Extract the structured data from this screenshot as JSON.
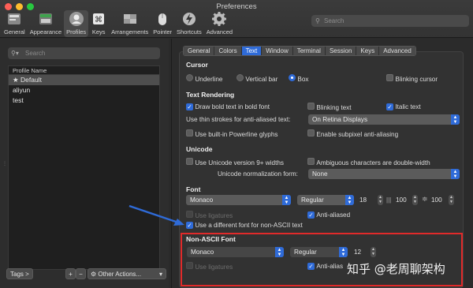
{
  "window": {
    "title": "Preferences"
  },
  "colors": {
    "accent": "#2f6bd8",
    "highlight_box": "#e02a2a",
    "arrow": "#2f6bd8"
  },
  "toolbar": {
    "items": [
      {
        "label": "General",
        "icon": "general-icon"
      },
      {
        "label": "Appearance",
        "icon": "appearance-icon"
      },
      {
        "label": "Profiles",
        "icon": "profiles-icon"
      },
      {
        "label": "Keys",
        "icon": "keys-icon"
      },
      {
        "label": "Arrangements",
        "icon": "arrangements-icon"
      },
      {
        "label": "Pointer",
        "icon": "pointer-icon"
      },
      {
        "label": "Shortcuts",
        "icon": "shortcuts-icon"
      },
      {
        "label": "Advanced",
        "icon": "advanced-icon"
      }
    ],
    "search_placeholder": "Search"
  },
  "profiles": {
    "search_placeholder": "Search",
    "column_header": "Profile Name",
    "items": [
      {
        "name": "Default",
        "default_marker": "★"
      },
      {
        "name": "aliyun"
      },
      {
        "name": "test"
      }
    ],
    "tags_button": "Tags >",
    "add_button": "+",
    "remove_button": "−",
    "other_actions": "Other Actions..."
  },
  "tabs": [
    "General",
    "Colors",
    "Text",
    "Window",
    "Terminal",
    "Session",
    "Keys",
    "Advanced"
  ],
  "text_settings": {
    "cursor": {
      "heading": "Cursor",
      "options": [
        "Underline",
        "Vertical bar",
        "Box"
      ],
      "blinking": "Blinking cursor"
    },
    "rendering": {
      "heading": "Text Rendering",
      "bold": "Draw bold text in bold font",
      "blinking_text": "Blinking text",
      "italic": "Italic text",
      "thin_strokes_label": "Use thin strokes for anti-aliased text:",
      "thin_strokes_value": "On Retina Displays",
      "powerline": "Use built-in Powerline glyphs",
      "subpixel": "Enable subpixel anti-aliasing"
    },
    "unicode": {
      "heading": "Unicode",
      "version": "Use Unicode version 9+ widths",
      "ambiguous": "Ambiguous characters are double-width",
      "normalization_label": "Unicode normalization form:",
      "normalization_value": "None"
    },
    "font": {
      "heading": "Font",
      "family": "Monaco",
      "style": "Regular",
      "size": "18",
      "h_spacing": "100",
      "v_spacing": "100",
      "ligatures": "Use ligatures",
      "anti_aliased": "Anti-aliased",
      "different_non_ascii": "Use a different font for non-ASCII text"
    },
    "non_ascii_font": {
      "heading": "Non-ASCII Font",
      "family": "Monaco",
      "style": "Regular",
      "size": "12",
      "ligatures": "Use ligatures",
      "anti_aliased": "Anti-alias"
    }
  },
  "watermark": "知乎 @老周聊架构"
}
